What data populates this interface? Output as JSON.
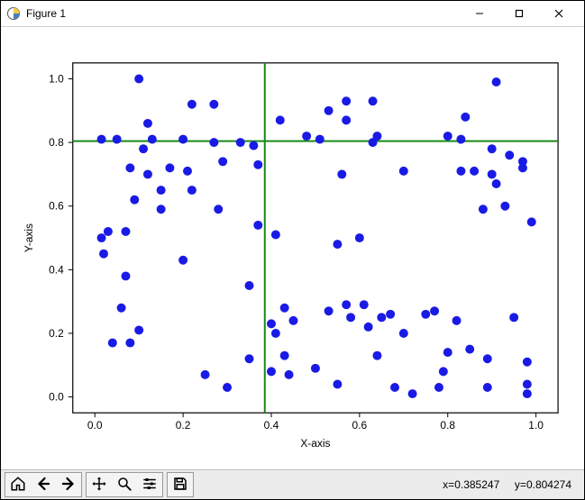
{
  "window": {
    "title": "Figure 1"
  },
  "status": {
    "x_label": "x=",
    "x_value": "0.385247",
    "y_label": "y=",
    "y_value": "0.804274"
  },
  "chart_data": {
    "type": "scatter",
    "xlabel": "X-axis",
    "ylabel": "Y-axis",
    "xlim": [
      -0.05,
      1.05
    ],
    "ylim": [
      -0.05,
      1.05
    ],
    "xticks": [
      0.0,
      0.2,
      0.4,
      0.6,
      0.8,
      1.0
    ],
    "yticks": [
      0.0,
      0.2,
      0.4,
      0.6,
      0.8,
      1.0
    ],
    "cursor": {
      "x": 0.385247,
      "y": 0.804274,
      "color": "#178a17"
    },
    "marker": {
      "radius_px": 5,
      "color": "#1a1ae6"
    },
    "points": [
      [
        0.015,
        0.5
      ],
      [
        0.015,
        0.81
      ],
      [
        0.02,
        0.45
      ],
      [
        0.03,
        0.52
      ],
      [
        0.04,
        0.17
      ],
      [
        0.05,
        0.81
      ],
      [
        0.06,
        0.28
      ],
      [
        0.07,
        0.38
      ],
      [
        0.07,
        0.52
      ],
      [
        0.08,
        0.17
      ],
      [
        0.08,
        0.72
      ],
      [
        0.09,
        0.62
      ],
      [
        0.1,
        1.0
      ],
      [
        0.1,
        0.21
      ],
      [
        0.11,
        0.78
      ],
      [
        0.12,
        0.86
      ],
      [
        0.12,
        0.7
      ],
      [
        0.13,
        0.81
      ],
      [
        0.15,
        0.65
      ],
      [
        0.15,
        0.59
      ],
      [
        0.17,
        0.72
      ],
      [
        0.2,
        0.43
      ],
      [
        0.2,
        0.81
      ],
      [
        0.21,
        0.71
      ],
      [
        0.22,
        0.65
      ],
      [
        0.22,
        0.92
      ],
      [
        0.25,
        0.07
      ],
      [
        0.27,
        0.8
      ],
      [
        0.27,
        0.92
      ],
      [
        0.28,
        0.59
      ],
      [
        0.29,
        0.74
      ],
      [
        0.3,
        0.03
      ],
      [
        0.33,
        0.8
      ],
      [
        0.35,
        0.35
      ],
      [
        0.35,
        0.12
      ],
      [
        0.36,
        0.79
      ],
      [
        0.37,
        0.54
      ],
      [
        0.37,
        0.73
      ],
      [
        0.4,
        0.08
      ],
      [
        0.4,
        0.23
      ],
      [
        0.41,
        0.2
      ],
      [
        0.41,
        0.51
      ],
      [
        0.42,
        0.87
      ],
      [
        0.43,
        0.13
      ],
      [
        0.43,
        0.28
      ],
      [
        0.44,
        0.07
      ],
      [
        0.45,
        0.24
      ],
      [
        0.48,
        0.82
      ],
      [
        0.5,
        0.09
      ],
      [
        0.51,
        0.81
      ],
      [
        0.53,
        0.9
      ],
      [
        0.53,
        0.27
      ],
      [
        0.55,
        0.04
      ],
      [
        0.55,
        0.48
      ],
      [
        0.56,
        0.7
      ],
      [
        0.57,
        0.29
      ],
      [
        0.57,
        0.87
      ],
      [
        0.57,
        0.93
      ],
      [
        0.58,
        0.25
      ],
      [
        0.6,
        0.5
      ],
      [
        0.61,
        0.29
      ],
      [
        0.62,
        0.22
      ],
      [
        0.63,
        0.93
      ],
      [
        0.63,
        0.8
      ],
      [
        0.64,
        0.82
      ],
      [
        0.64,
        0.13
      ],
      [
        0.65,
        0.25
      ],
      [
        0.67,
        0.26
      ],
      [
        0.68,
        0.03
      ],
      [
        0.7,
        0.71
      ],
      [
        0.7,
        0.2
      ],
      [
        0.72,
        0.01
      ],
      [
        0.75,
        0.26
      ],
      [
        0.77,
        0.27
      ],
      [
        0.78,
        0.03
      ],
      [
        0.79,
        0.08
      ],
      [
        0.8,
        0.14
      ],
      [
        0.8,
        0.82
      ],
      [
        0.82,
        0.24
      ],
      [
        0.83,
        0.81
      ],
      [
        0.83,
        0.71
      ],
      [
        0.84,
        0.88
      ],
      [
        0.85,
        0.15
      ],
      [
        0.86,
        0.71
      ],
      [
        0.88,
        0.59
      ],
      [
        0.89,
        0.03
      ],
      [
        0.89,
        0.12
      ],
      [
        0.9,
        0.78
      ],
      [
        0.9,
        0.7
      ],
      [
        0.91,
        0.67
      ],
      [
        0.91,
        0.99
      ],
      [
        0.93,
        0.6
      ],
      [
        0.94,
        0.76
      ],
      [
        0.95,
        0.25
      ],
      [
        0.97,
        0.74
      ],
      [
        0.97,
        0.72
      ],
      [
        0.98,
        0.01
      ],
      [
        0.98,
        0.04
      ],
      [
        0.98,
        0.11
      ],
      [
        0.99,
        0.55
      ]
    ]
  }
}
